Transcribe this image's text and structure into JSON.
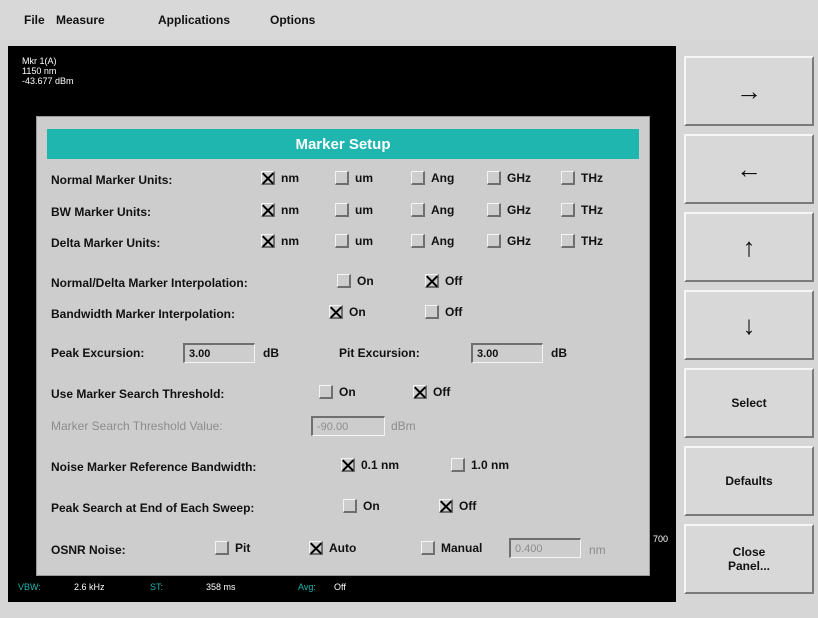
{
  "menu": {
    "file": "File",
    "measure": "Measure",
    "applications": "Applications",
    "options": "Options"
  },
  "display": {
    "marker_readout": [
      "Mkr 1(A)",
      "1150 nm",
      "-43.677 dBm"
    ],
    "right_edge_label": "700",
    "status": {
      "vbw_label": "VBW:",
      "vbw_value": "2.6 kHz",
      "st_label": "ST:",
      "st_value": "358 ms",
      "avg_label": "Avg:",
      "avg_value": "Off"
    }
  },
  "softkeys": {
    "right_arrow": "→",
    "left_arrow": "←",
    "up_arrow": "↑",
    "down_arrow": "↓",
    "select": "Select",
    "defaults": "Defaults",
    "close_panel": "Close Panel..."
  },
  "dialog": {
    "title": "Marker Setup",
    "unit_options": [
      "nm",
      "um",
      "Ang",
      "GHz",
      "THz"
    ],
    "normal_units": {
      "label": "Normal Marker Units:",
      "selected": "nm"
    },
    "bw_units": {
      "label": "BW Marker Units:",
      "selected": "nm"
    },
    "delta_units": {
      "label": "Delta Marker Units:",
      "selected": "nm"
    },
    "on_label": "On",
    "off_label": "Off",
    "normal_delta_interp": {
      "label": "Normal/Delta Marker Interpolation:",
      "on": false,
      "off": true
    },
    "bw_interp": {
      "label": "Bandwidth Marker Interpolation:",
      "on": true,
      "off": false
    },
    "peak_excursion": {
      "label": "Peak Excursion:",
      "value": "3.00",
      "unit": "dB"
    },
    "pit_excursion": {
      "label": "Pit Excursion:",
      "value": "3.00",
      "unit": "dB"
    },
    "search_threshold": {
      "label": "Use Marker Search Threshold:",
      "on": false,
      "off": true
    },
    "threshold_value": {
      "label": "Marker Search Threshold Value:",
      "value": "-90.00",
      "unit": "dBm"
    },
    "noise_ref_bw": {
      "label": "Noise Marker Reference Bandwidth:",
      "opt1": "0.1 nm",
      "opt2": "1.0 nm",
      "selected": "0.1 nm"
    },
    "peak_search_end": {
      "label": "Peak Search at End of Each Sweep:",
      "on": false,
      "off": true
    },
    "osnr_noise": {
      "label": "OSNR Noise:",
      "pit": "Pit",
      "auto": "Auto",
      "manual": "Manual",
      "selected": "Auto",
      "manual_value": "0.400",
      "manual_unit": "nm"
    }
  }
}
